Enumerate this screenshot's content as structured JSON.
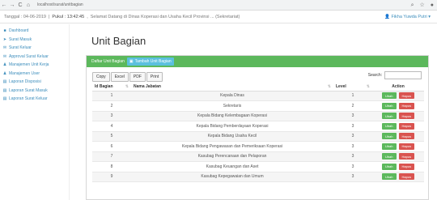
{
  "browser": {
    "url": "localhost/surat/unitbagian",
    "back": "←",
    "forward": "→",
    "reload": "C",
    "home": "⌂"
  },
  "topbar": {
    "date_label": "Tanggal : 04-06-2019",
    "time_label": "Pukul : 13:42:45",
    "welcome": "Selamat Datang di Dinas Koperasi dan Usaha Kecil Provinsi ... (Sekretariat)",
    "user": "Fikha Yuwda Putri"
  },
  "sidebar": {
    "items": [
      {
        "label": "Dashboard",
        "icon": "dashboard-icon"
      },
      {
        "label": "Surat Masuk",
        "icon": "send-icon"
      },
      {
        "label": "Surat Keluar",
        "icon": "envelope-icon"
      },
      {
        "label": "Approval Surat Keluar",
        "icon": "envelope-icon"
      },
      {
        "label": "Manajemen Unit Kerja",
        "icon": "user-icon"
      },
      {
        "label": "Manajemen User",
        "icon": "user-icon"
      },
      {
        "label": "Laporan Disposisi",
        "icon": "document-icon"
      },
      {
        "label": "Laporan Surat Masuk",
        "icon": "document-icon"
      },
      {
        "label": "Laporan Surat Keluar",
        "icon": "document-icon"
      }
    ]
  },
  "main": {
    "title": "Unit Bagian",
    "panel": {
      "heading": "Daftar Unit Bagian",
      "add_button": "Tambah Unit Bagian"
    },
    "toolbar": [
      "Copy",
      "Excel",
      "PDF",
      "Print"
    ],
    "search": {
      "label": "Search:",
      "value": ""
    },
    "table": {
      "headers": [
        "Id Bagian",
        "Nama Jabatan",
        "Level",
        "Action"
      ],
      "rows": [
        {
          "id": "1",
          "nama": "Kepala Dinas",
          "level": "1"
        },
        {
          "id": "2",
          "nama": "Sekretaris",
          "level": "2"
        },
        {
          "id": "3",
          "nama": "Kepala Bidang Kelembagaan Koperasi",
          "level": "3"
        },
        {
          "id": "4",
          "nama": "Kepala Bidang Pemberdayaan Koperasi",
          "level": "3"
        },
        {
          "id": "5",
          "nama": "Kepala Bidang Usaha Kecil",
          "level": "3"
        },
        {
          "id": "6",
          "nama": "Kepala Bidang Pengawasan dan Pemeriksaan Koperasi",
          "level": "3"
        },
        {
          "id": "7",
          "nama": "Kasubag Perencanaan dan Pelaporan",
          "level": "3"
        },
        {
          "id": "8",
          "nama": "Kasubag Keuangan dan Aset",
          "level": "3"
        },
        {
          "id": "9",
          "nama": "Kasubag Kepegawaian dan Umum",
          "level": "3"
        }
      ],
      "edit_label": "Ubah",
      "delete_label": "Hapus"
    }
  }
}
